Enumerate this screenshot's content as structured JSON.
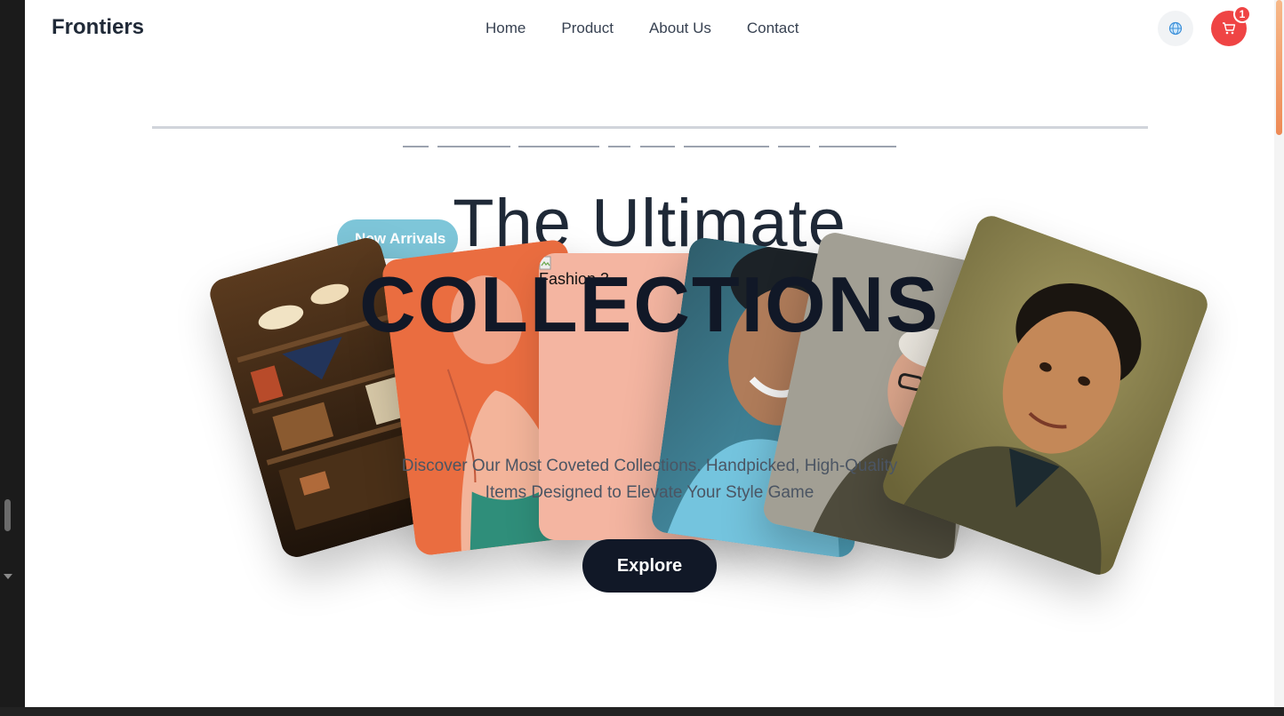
{
  "header": {
    "logo": "Frontiers",
    "nav": [
      "Home",
      "Product",
      "About Us",
      "Contact"
    ],
    "lang_icon": "globe-icon",
    "cart_icon": "cart-icon",
    "cart_count": "1"
  },
  "hero": {
    "badge": "New Arrivals",
    "headline_line1": "The Ultimate",
    "headline_line2": "COLLECTIONS",
    "broken_image_alt": "Fashion 3",
    "subtitle_line1": "Discover Our Most Coveted Collections. Handpicked, High-Quality",
    "subtitle_line2": "Items Designed to Elevate Your Style Game",
    "cta": "Explore"
  },
  "colors": {
    "accent": "#111827",
    "cart": "#ef4444",
    "badge": "#7ec6d9"
  }
}
